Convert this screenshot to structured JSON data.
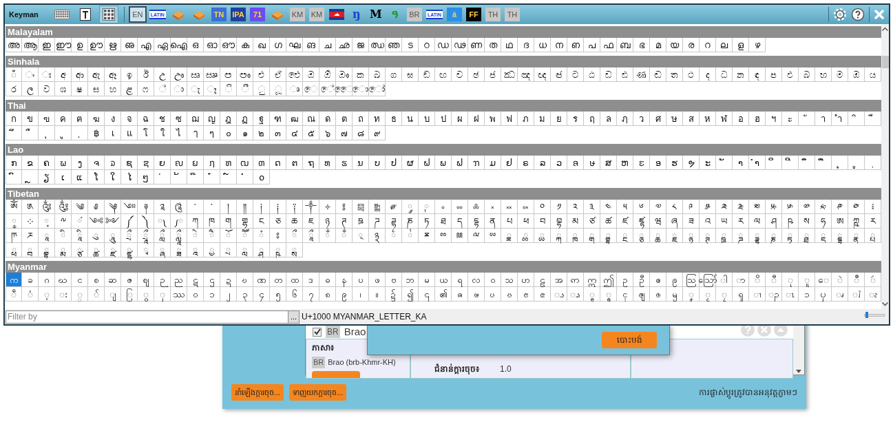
{
  "toolbar": {
    "title": "Keyman",
    "tools": [
      {
        "kind": "keyboard",
        "selected": false
      },
      {
        "kind": "text",
        "selected": false
      },
      {
        "kind": "charmap",
        "selected": true
      }
    ],
    "keyboards": [
      {
        "kind": "chip",
        "label": "EN",
        "selected": true
      },
      {
        "kind": "framed",
        "label": "LATIN",
        "color": "#1a3fd0",
        "selected": false
      },
      {
        "kind": "cube",
        "selected": false
      },
      {
        "kind": "cube",
        "selected": false
      },
      {
        "kind": "solid",
        "label": "TN",
        "color": "#3b6fd6",
        "selected": false
      },
      {
        "kind": "solid",
        "label": "IPA",
        "color": "#1f3fa0",
        "selected": false
      },
      {
        "kind": "solid",
        "label": "71",
        "color": "#6a4cf0",
        "selected": false
      },
      {
        "kind": "cube",
        "selected": false
      },
      {
        "kind": "chip",
        "label": "KM",
        "selected": false
      },
      {
        "kind": "chip",
        "label": "KM",
        "selected": false
      },
      {
        "kind": "flag",
        "selected": false
      },
      {
        "kind": "glyph",
        "label": "ŋ",
        "color": "#1f3fd0",
        "selected": false
      },
      {
        "kind": "glyph",
        "label": "M",
        "color": "#000000",
        "selected": false
      },
      {
        "kind": "glyph",
        "label": "ዓ",
        "color": "#1a9a1a",
        "selected": false
      },
      {
        "kind": "chip",
        "label": "BR",
        "selected": false
      },
      {
        "kind": "framed",
        "label": "LATIN",
        "color": "#1a3fd0",
        "selected": false
      },
      {
        "kind": "solid",
        "label": "ä",
        "color": "#2a8fe8",
        "selected": false
      },
      {
        "kind": "solid",
        "label": "FF",
        "color": "#000000",
        "selected": false
      },
      {
        "kind": "chip",
        "label": "TH",
        "selected": false
      },
      {
        "kind": "chip",
        "label": "TH",
        "selected": false
      }
    ],
    "actions": [
      {
        "kind": "settings"
      },
      {
        "kind": "help"
      },
      {
        "kind": "close"
      }
    ]
  },
  "charmap": {
    "sections": [
      {
        "title": "Malayalam",
        "rows": [
          [
            "അ",
            "ആ",
            "ഇ",
            "ഈ",
            "ഉ",
            "ഊ",
            "ഋ",
            "ഌ",
            "എ",
            "ഏ",
            "ഐ",
            "ഒ",
            "ഓ",
            "ഔ",
            "ക",
            "ഖ",
            "ഗ",
            "ഘ",
            "ങ",
            "ച",
            "ഛ",
            "ജ",
            "ഝ",
            "ഞ",
            "ട",
            "ഠ",
            "ഡ",
            "ഢ",
            "ണ",
            "ത",
            "ഥ",
            "ദ",
            "ധ",
            "ന",
            "ഩ",
            "പ",
            "ഫ",
            "ബ",
            "ഭ",
            "മ",
            "യ",
            "ര",
            "റ",
            "ല",
            "ള",
            "ഴ"
          ]
        ]
      },
      {
        "title": "Sinhala",
        "rows": [
          [
            "ඁ",
            "ං",
            "ඃ",
            "අ",
            "ආ",
            "ඇ",
            "ඈ",
            "ඉ",
            "ඊ",
            "උ",
            "ඌ",
            "ඍ",
            "ඎ",
            "ඏ",
            "ඐ",
            "එ",
            "ඒ",
            "ඓ",
            "ඔ",
            "ඕ",
            "ඖ",
            "ක",
            "ඛ",
            "ග",
            "ඝ",
            "ඞ",
            "ඟ",
            "ච",
            "ඡ",
            "ජ",
            "ඣ",
            "ඤ",
            "ඥ",
            "ඦ",
            "ට",
            "ඨ",
            "ඩ",
            "ඪ",
            "ණ",
            "ඬ",
            "ත",
            "ථ",
            "ද",
            "ධ",
            "න",
            "ඳ",
            "ප",
            "ඵ",
            "බ",
            "භ",
            "ම",
            "ඹ",
            "ය"
          ],
          [
            "ර",
            "ල",
            "ව",
            "ශ",
            "ෂ",
            "ස",
            "හ",
            "ළ",
            "ෆ",
            "්",
            "ා",
            "ැ",
            "ෑ",
            "ි",
            "ී",
            "ු",
            "ූ",
            "ෘ",
            "ෙ",
            "ේ",
            "ෛ",
            "ො",
            "ෝ"
          ]
        ]
      },
      {
        "title": "Thai",
        "rows": [
          [
            "ก",
            "ข",
            "ฃ",
            "ค",
            "ฅ",
            "ฆ",
            "ง",
            "จ",
            "ฉ",
            "ช",
            "ซ",
            "ฌ",
            "ญ",
            "ฎ",
            "ฏ",
            "ฐ",
            "ฑ",
            "ฒ",
            "ณ",
            "ด",
            "ต",
            "ถ",
            "ท",
            "ธ",
            "น",
            "บ",
            "ป",
            "ผ",
            "ฝ",
            "พ",
            "ฟ",
            "ภ",
            "ม",
            "ย",
            "ร",
            "ฤ",
            "ล",
            "ฦ",
            "ว",
            "ศ",
            "ษ",
            "ส",
            "ห",
            "ฬ",
            "อ",
            "ฮ",
            "ฯ",
            "ะ",
            "ั",
            "า",
            "ำ",
            "ิ",
            "ี"
          ],
          [
            "ึ",
            "ื",
            "ุ",
            "ู",
            "ฺ",
            "฿",
            "เ",
            "แ",
            "โ",
            "ใ",
            "ไ",
            "ๅ",
            "ๆ",
            "๐",
            "๑",
            "๒",
            "๓",
            "๔",
            "๕",
            "๖",
            "๗",
            "๘",
            "๙"
          ]
        ]
      },
      {
        "title": "Lao",
        "rows": [
          [
            "ກ",
            "ຂ",
            "ຄ",
            "ຆ",
            "ງ",
            "ຈ",
            "ຉ",
            "ຊ",
            "ຌ",
            "ຍ",
            "ຎ",
            "ຏ",
            "ຐ",
            "ຑ",
            "ຒ",
            "ຓ",
            "ດ",
            "ຕ",
            "ຖ",
            "ທ",
            "ຘ",
            "ນ",
            "ບ",
            "ປ",
            "ຜ",
            "ຝ",
            "ພ",
            "ຟ",
            "ຠ",
            "ມ",
            "ຢ",
            "ຣ",
            "ລ",
            "ວ",
            "ຨ",
            "ຩ",
            "ສ",
            "ຫ",
            "ຬ",
            "ອ",
            "ຮ",
            "ຯ",
            "ະ",
            "ັ",
            "າ",
            "ຳ",
            "ິ",
            "ີ",
            "ຶ",
            "ື",
            "ຸ",
            "ູ",
            "຺"
          ],
          [
            "ົ",
            "ຼ",
            "ຽ",
            "ເ",
            "ແ",
            "ໂ",
            "ໃ",
            "ໄ",
            "ໆ",
            "່",
            "້",
            "໊",
            "໋",
            "໌",
            "ໍ",
            "໐"
          ]
        ]
      },
      {
        "title": "Tibetan",
        "rows": [
          [
            "ༀ",
            "༁",
            "༂",
            "༃",
            "༄",
            "༅",
            "༆",
            "༇",
            "༈",
            "༉",
            "༊",
            "་",
            "༌",
            "།",
            "༎",
            "༏",
            "༐",
            "༑",
            "༒",
            "༓",
            "༔",
            "༕",
            "༖",
            "༗",
            "༘",
            "༙",
            "༚",
            "༛",
            "༜",
            "༝",
            "༞",
            "༟",
            "༠",
            "༡",
            "༢",
            "༣",
            "༤",
            "༥",
            "༦",
            "༧",
            "༨",
            "༩",
            "༪",
            "༫",
            "༬",
            "༭",
            "༮",
            "༯",
            "༰",
            "༱",
            "༲",
            "༳",
            "༴"
          ],
          [
            "༵",
            "༶",
            "༷",
            "༸",
            "༹",
            "༺",
            "༻",
            "༼",
            "༽",
            "༾",
            "༿",
            "ཀ",
            "ཁ",
            "ག",
            "གྷ",
            "ང",
            "ཅ",
            "ཆ",
            "ཇ",
            "ཉ",
            "ཊ",
            "ཋ",
            "ཌ",
            "ཌྷ",
            "ཎ",
            "ཏ",
            "ཐ",
            "ད",
            "དྷ",
            "ན",
            "པ",
            "ཕ",
            "བ",
            "བྷ",
            "མ",
            "ཙ",
            "ཚ",
            "ཛ",
            "ཛྷ",
            "ཝ",
            "ཞ",
            "ཟ",
            "འ",
            "ཡ",
            "ར",
            "ལ",
            "ཤ",
            "ཥ",
            "ས",
            "ཧ",
            "ཨ",
            "ཀྵ",
            "ཪ"
          ],
          [
            "ཫ",
            "ཬ",
            "ཱ",
            "ི",
            "ཱི",
            "ུ",
            "ཱུ",
            "ྲྀ",
            "ཷ",
            "ླྀ",
            "ཹ",
            "ེ",
            "ཻ",
            "ོ",
            "ཽ",
            "ཾ",
            "ཿ",
            "ྀ",
            "ཱྀ",
            "ྂ",
            "ྃ",
            "྄",
            "྅",
            "྆",
            "྇",
            "ྈ",
            "ྉ",
            "ྊ",
            "ྋ",
            "ྌ",
            "ྍ",
            "ྎ",
            "ྏ",
            "ྐ",
            "ྑ",
            "ྒ",
            "ྒྷ",
            "ྔ",
            "ྕ",
            "ྖ",
            "ྗ",
            "ྙ",
            "ྚ",
            "ྛ",
            "ྜ",
            "ྜྷ",
            "ྞ",
            "ྟ",
            "ྠ",
            "ྡ",
            "ྡྷ",
            "ྣ",
            "ྤ"
          ],
          [
            "ྥ",
            "ྦ",
            "ྦྷ",
            "ྨ",
            "ྩ",
            "ྪ",
            "ྫ",
            "ྫྷ",
            "ྭ",
            "ྮ",
            "ྯ",
            "ྰ",
            "ྱ",
            "ྲ",
            "ླ",
            "ྴ",
            "ྵ",
            "ྶ"
          ]
        ]
      },
      {
        "title": "Myanmar",
        "rows": [
          [
            {
              "char": "က",
              "selected": true
            },
            "ခ",
            "ဂ",
            "ဃ",
            "င",
            "စ",
            "ဆ",
            "ဇ",
            "ဈ",
            "ဉ",
            "ည",
            "ဋ",
            "ဌ",
            "ဍ",
            "ဎ",
            "ဏ",
            "တ",
            "ထ",
            "ဒ",
            "ဓ",
            "န",
            "ပ",
            "ဖ",
            "ဗ",
            "ဘ",
            "မ",
            "ယ",
            "ရ",
            "လ",
            "ဝ",
            "သ",
            "ဟ",
            "ဠ",
            "အ",
            "ဢ",
            "ဣ",
            "ဤ",
            "ဥ",
            "ဦ",
            "ဧ",
            "ဨ",
            "ဩ",
            "ဪ",
            "ါ",
            "ာ",
            "ိ",
            "ီ",
            "ု",
            "ူ",
            "ေ",
            "ဲ",
            "ဳ",
            "ဴ"
          ],
          [
            "ဵ",
            "ံ",
            "့",
            "း",
            "္",
            "်",
            "ျ",
            "ြ",
            "ွ",
            "ှ",
            "ဿ",
            "၀",
            "၁",
            "၂",
            "၃",
            "၄",
            "၅",
            "၆",
            "၇",
            "၈",
            "၉",
            "၊",
            "။",
            "၌",
            "၍",
            "၎",
            "၏",
            "ၐ",
            "ၑ",
            "ၒ",
            "ၓ",
            "ၔ",
            "ၕ",
            "ၖ",
            "ၗ",
            "ၘ",
            "ၙ",
            "ၚ",
            "ၛ",
            "ၜ",
            "ၝ",
            "ၞ",
            "ၟ",
            "ၠ",
            "ၡ",
            "ၢ",
            "ၣ",
            "ၤ",
            "ၥ",
            "ၦ",
            "ၧ",
            "ၨ",
            "ၩ"
          ]
        ]
      }
    ]
  },
  "filter": {
    "placeholder": "Filter by",
    "button": "...",
    "status": "U+1000 MYANMAR_LETTER_KA",
    "zoom": {
      "level": 0.05
    }
  },
  "dialog": {
    "list_item": {
      "checked": true,
      "badge": "BR",
      "name": "Brao"
    },
    "details": {
      "language_label": "ភាសា៖",
      "language": {
        "badge": "BR",
        "name": "Brao (brb-Khmr-KH)"
      },
      "version_label": "ជំនាន់ក្តារចុច៖",
      "version": "1.0"
    },
    "buttons": [
      "នាំឡើងក្ដារចុច...",
      "ទាញយកក្ដារចុច..."
    ],
    "note": "ការផ្លាស់ប្តូរត្រូវបានអនុវត្តភ្លាមៗ"
  },
  "popup": {
    "button": "បោះបង់"
  }
}
